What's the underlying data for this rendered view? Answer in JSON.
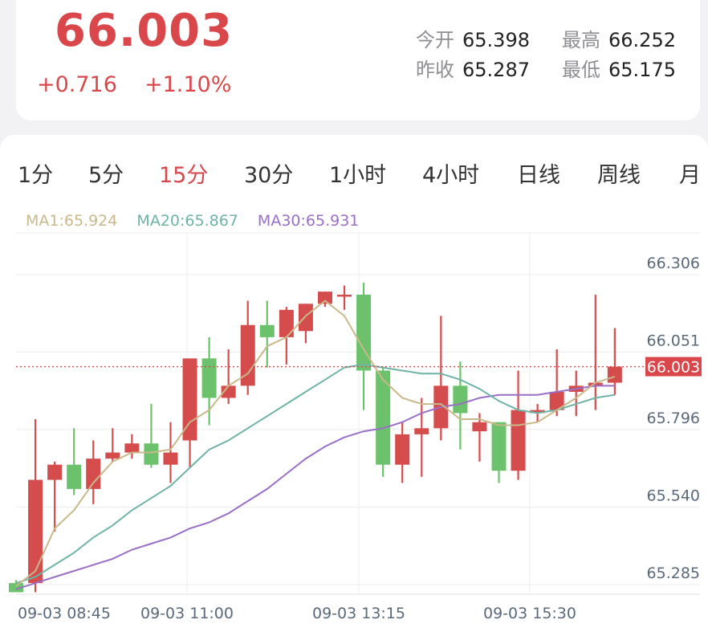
{
  "quote": {
    "price": "66.003",
    "change": "+0.716",
    "change_pct": "+1.10%",
    "open_label": "今开",
    "open": "65.398",
    "high_label": "最高",
    "high": "66.252",
    "prev_close_label": "昨收",
    "prev_close": "65.287",
    "low_label": "最低",
    "low": "65.175"
  },
  "tabs": [
    {
      "label": "1分",
      "active": false
    },
    {
      "label": "5分",
      "active": false
    },
    {
      "label": "15分",
      "active": true
    },
    {
      "label": "30分",
      "active": false
    },
    {
      "label": "1小时",
      "active": false
    },
    {
      "label": "4小时",
      "active": false
    },
    {
      "label": "日线",
      "active": false
    },
    {
      "label": "周线",
      "active": false
    },
    {
      "label": "月",
      "active": false
    }
  ],
  "ma_legend": {
    "ma1": "MA1:65.924",
    "ma20": "MA20:65.867",
    "ma30": "MA30:65.931"
  },
  "colors": {
    "up": "#d44c4c",
    "down": "#6cc26c",
    "ma1": "#c9b88a",
    "ma20": "#6fb3a6",
    "ma30": "#9a6fc6",
    "accent": "#d9474b"
  },
  "chart_data": {
    "type": "candlestick",
    "ylim": [
      65.285,
      66.306
    ],
    "y_ticks": [
      "66.306",
      "66.051",
      "65.796",
      "65.540",
      "65.285"
    ],
    "x_ticks": [
      "09-03 08:45",
      "09-03 11:00",
      "09-03 13:15",
      "09-03 15:30"
    ],
    "current_price": "66.003",
    "candles": [
      {
        "o": 65.29,
        "h": 65.3,
        "l": 65.26,
        "c": 65.26
      },
      {
        "o": 65.29,
        "h": 65.83,
        "l": 65.26,
        "c": 65.63
      },
      {
        "o": 65.63,
        "h": 65.69,
        "l": 65.46,
        "c": 65.68
      },
      {
        "o": 65.68,
        "h": 65.8,
        "l": 65.58,
        "c": 65.6
      },
      {
        "o": 65.6,
        "h": 65.76,
        "l": 65.55,
        "c": 65.7
      },
      {
        "o": 65.7,
        "h": 65.8,
        "l": 65.69,
        "c": 65.72
      },
      {
        "o": 65.72,
        "h": 65.78,
        "l": 65.7,
        "c": 65.75
      },
      {
        "o": 65.75,
        "h": 65.88,
        "l": 65.67,
        "c": 65.68
      },
      {
        "o": 65.68,
        "h": 65.82,
        "l": 65.62,
        "c": 65.72
      },
      {
        "o": 65.76,
        "h": 66.03,
        "l": 65.67,
        "c": 66.03
      },
      {
        "o": 66.03,
        "h": 66.1,
        "l": 65.81,
        "c": 65.9
      },
      {
        "o": 65.9,
        "h": 66.06,
        "l": 65.88,
        "c": 65.94
      },
      {
        "o": 65.94,
        "h": 66.22,
        "l": 65.91,
        "c": 66.14
      },
      {
        "o": 66.14,
        "h": 66.22,
        "l": 66.0,
        "c": 66.1
      },
      {
        "o": 66.1,
        "h": 66.2,
        "l": 66.01,
        "c": 66.19
      },
      {
        "o": 66.12,
        "h": 66.21,
        "l": 66.08,
        "c": 66.21
      },
      {
        "o": 66.21,
        "h": 66.25,
        "l": 66.2,
        "c": 66.25
      },
      {
        "o": 66.24,
        "h": 66.27,
        "l": 66.19,
        "c": 66.24
      },
      {
        "o": 66.24,
        "h": 66.28,
        "l": 65.86,
        "c": 65.99
      },
      {
        "o": 65.99,
        "h": 66.0,
        "l": 65.64,
        "c": 65.68
      },
      {
        "o": 65.68,
        "h": 65.82,
        "l": 65.62,
        "c": 65.78
      },
      {
        "o": 65.78,
        "h": 65.9,
        "l": 65.64,
        "c": 65.8
      },
      {
        "o": 65.8,
        "h": 66.17,
        "l": 65.76,
        "c": 65.94
      },
      {
        "o": 65.94,
        "h": 66.02,
        "l": 65.73,
        "c": 65.85
      },
      {
        "o": 65.79,
        "h": 65.85,
        "l": 65.69,
        "c": 65.82
      },
      {
        "o": 65.82,
        "h": 65.82,
        "l": 65.62,
        "c": 65.66
      },
      {
        "o": 65.66,
        "h": 65.99,
        "l": 65.63,
        "c": 65.86
      },
      {
        "o": 65.85,
        "h": 65.88,
        "l": 65.82,
        "c": 65.86
      },
      {
        "o": 65.86,
        "h": 66.06,
        "l": 65.84,
        "c": 65.92
      },
      {
        "o": 65.92,
        "h": 65.99,
        "l": 65.84,
        "c": 65.94
      },
      {
        "o": 65.94,
        "h": 66.24,
        "l": 65.86,
        "c": 65.95
      },
      {
        "o": 65.95,
        "h": 66.13,
        "l": 65.91,
        "c": 66.003
      }
    ],
    "ma1": [
      65.28,
      65.33,
      65.47,
      65.53,
      65.62,
      65.69,
      65.72,
      65.72,
      65.73,
      65.82,
      65.86,
      65.94,
      65.98,
      66.07,
      66.1,
      66.17,
      66.22,
      66.17,
      66.06,
      65.96,
      65.9,
      65.88,
      65.88,
      65.83,
      65.83,
      65.81,
      65.81,
      65.82,
      65.86,
      65.9,
      65.95,
      65.97
    ],
    "ma20": [
      65.29,
      65.31,
      65.35,
      65.39,
      65.44,
      65.48,
      65.53,
      65.57,
      65.61,
      65.67,
      65.73,
      65.76,
      65.8,
      65.84,
      65.88,
      65.92,
      65.96,
      66.0,
      66.01,
      66.0,
      65.99,
      65.98,
      65.98,
      65.96,
      65.93,
      65.89,
      65.86,
      65.85,
      65.86,
      65.88,
      65.9,
      65.91
    ],
    "ma30": [
      65.27,
      65.29,
      65.31,
      65.33,
      65.35,
      65.37,
      65.4,
      65.42,
      65.44,
      65.47,
      65.49,
      65.52,
      65.56,
      65.6,
      65.65,
      65.7,
      65.74,
      65.77,
      65.79,
      65.8,
      65.82,
      65.85,
      65.87,
      65.88,
      65.9,
      65.91,
      65.91,
      65.91,
      65.92,
      65.93,
      65.94,
      65.94
    ]
  }
}
